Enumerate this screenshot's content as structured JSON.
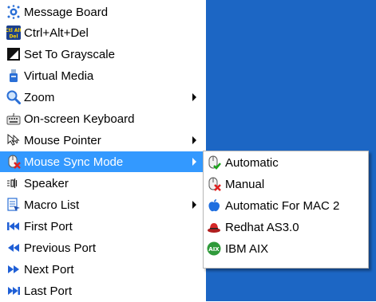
{
  "menu": {
    "items": [
      {
        "label": "Message Board",
        "icon": "message-board-icon"
      },
      {
        "label": "Ctrl+Alt+Del",
        "icon": "ctrl-alt-del-icon"
      },
      {
        "label": "Set To Grayscale",
        "icon": "grayscale-icon"
      },
      {
        "label": "Virtual Media",
        "icon": "usb-media-icon"
      },
      {
        "label": "Zoom",
        "icon": "magnifier-icon"
      },
      {
        "label": "On-screen Keyboard",
        "icon": "keyboard-icon"
      },
      {
        "label": "Mouse Pointer",
        "icon": "mouse-pointer-icon"
      },
      {
        "label": "Mouse Sync Mode",
        "icon": "mouse-sync-icon"
      },
      {
        "label": "Speaker",
        "icon": "speaker-icon"
      },
      {
        "label": "Macro List",
        "icon": "macro-list-icon"
      },
      {
        "label": "First Port",
        "icon": "first-port-icon"
      },
      {
        "label": "Previous Port",
        "icon": "previous-port-icon"
      },
      {
        "label": "Next Port",
        "icon": "next-port-icon"
      },
      {
        "label": "Last Port",
        "icon": "last-port-icon"
      }
    ],
    "selected": "Mouse Sync Mode"
  },
  "submenu": {
    "items": [
      {
        "label": "Automatic",
        "icon": "mouse-check-icon"
      },
      {
        "label": "Manual",
        "icon": "mouse-cross-icon"
      },
      {
        "label": "Automatic For MAC 2",
        "icon": "apple-icon"
      },
      {
        "label": "Redhat AS3.0",
        "icon": "redhat-icon"
      },
      {
        "label": "IBM AIX",
        "icon": "aix-icon"
      }
    ]
  },
  "colors": {
    "selection": "#3399ff",
    "desktop": "#1c66c4",
    "port_arrows": "#1f5fd6"
  }
}
